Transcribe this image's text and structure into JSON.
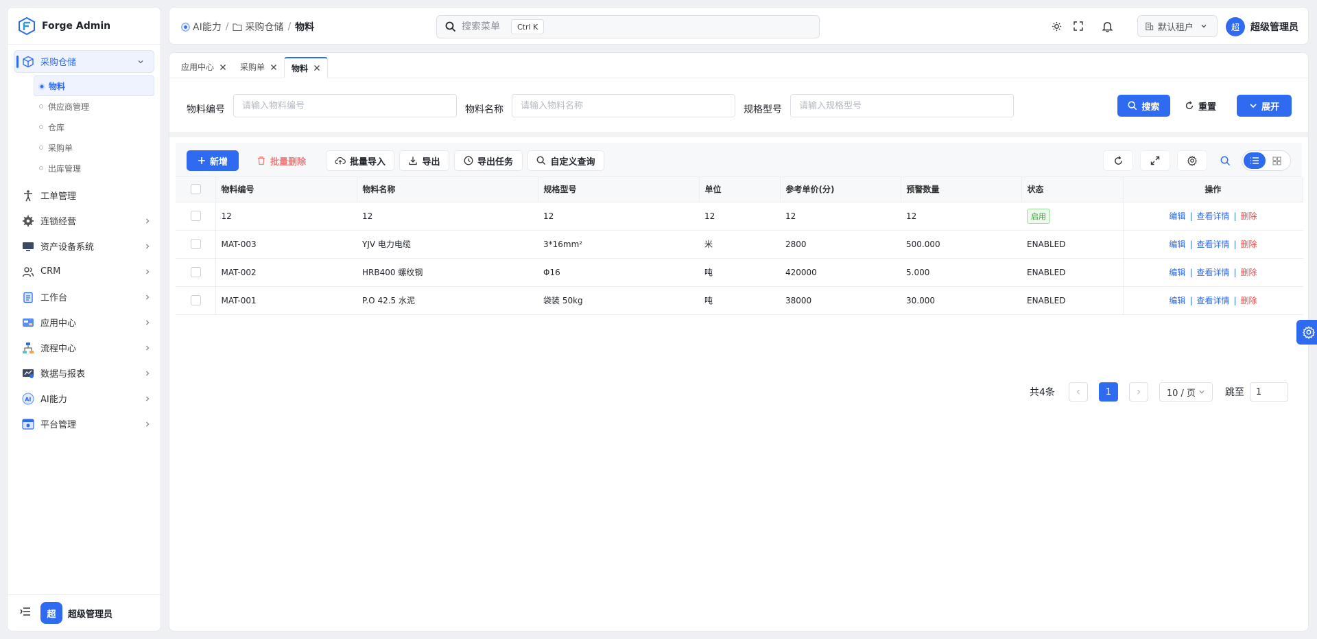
{
  "app": {
    "name": "Forge Admin"
  },
  "sidebar": {
    "open_group": {
      "label": "采购仓储",
      "icon": "cube-icon"
    },
    "sub_items": [
      {
        "label": "物料",
        "active": true
      },
      {
        "label": "供应商管理"
      },
      {
        "label": "仓库"
      },
      {
        "label": "采购单"
      },
      {
        "label": "出库管理"
      }
    ],
    "items": [
      {
        "label": "工单管理",
        "icon": "person-icon",
        "arrow": false
      },
      {
        "label": "连锁经营",
        "icon": "gear-icon",
        "arrow": true
      },
      {
        "label": "资产设备系统",
        "icon": "monitor-icon",
        "arrow": true
      },
      {
        "label": "CRM",
        "icon": "users-icon",
        "arrow": true
      },
      {
        "label": "工作台",
        "icon": "clipboard-icon",
        "arrow": true
      },
      {
        "label": "应用中心",
        "icon": "app-icon",
        "arrow": true
      },
      {
        "label": "流程中心",
        "icon": "flow-icon",
        "arrow": true
      },
      {
        "label": "数据与报表",
        "icon": "report-icon",
        "arrow": true
      },
      {
        "label": "AI能力",
        "icon": "ai-icon",
        "arrow": true
      },
      {
        "label": "平台管理",
        "icon": "platform-icon",
        "arrow": true
      }
    ],
    "bottom_user": {
      "avatar": "超",
      "name": "超级管理员"
    }
  },
  "header": {
    "breadcrumbs": [
      "AI能力",
      "采购仓储",
      "物料"
    ],
    "search": {
      "placeholder": "搜索菜单",
      "shortcut": "Ctrl K"
    },
    "tenant": "默认租户",
    "user": {
      "avatar": "超",
      "name": "超级管理员"
    }
  },
  "tabs": [
    {
      "label": "应用中心"
    },
    {
      "label": "采购单"
    },
    {
      "label": "物料",
      "active": true
    }
  ],
  "filter": {
    "fields": [
      {
        "label": "物料编号",
        "placeholder": "请输入物料编号",
        "value": ""
      },
      {
        "label": "物料名称",
        "placeholder": "请输入物料名称",
        "value": ""
      },
      {
        "label": "规格型号",
        "placeholder": "请输入规格型号",
        "value": ""
      }
    ],
    "search_label": "搜索",
    "reset_label": "重置",
    "expand_label": "展开"
  },
  "toolbar": {
    "add": "新增",
    "batch_delete": "批量删除",
    "batch_import": "批量导入",
    "export": "导出",
    "export_tasks": "导出任务",
    "custom_query": "自定义查询"
  },
  "table": {
    "columns": [
      "物料编号",
      "物料名称",
      "规格型号",
      "单位",
      "参考单价(分)",
      "预警数量",
      "状态",
      "操作"
    ],
    "rows": [
      {
        "code": "12",
        "name": "12",
        "spec": "12",
        "unit": "12",
        "price": "12",
        "warn": "12",
        "status": "启用",
        "status_tag": true
      },
      {
        "code": "MAT-003",
        "name": "YJV 电力电缆",
        "spec": "3*16mm²",
        "unit": "米",
        "price": "2800",
        "warn": "500.000",
        "status": "ENABLED"
      },
      {
        "code": "MAT-002",
        "name": "HRB400 螺纹钢",
        "spec": "Φ16",
        "unit": "吨",
        "price": "420000",
        "warn": "5.000",
        "status": "ENABLED"
      },
      {
        "code": "MAT-001",
        "name": "P.O 42.5 水泥",
        "spec": "袋装 50kg",
        "unit": "吨",
        "price": "38000",
        "warn": "30.000",
        "status": "ENABLED"
      }
    ],
    "ops": {
      "edit": "编辑",
      "detail": "查看详情",
      "delete": "删除",
      "sep": "|"
    }
  },
  "pagination": {
    "total_text": "共4条",
    "current_page": "1",
    "page_size": "10 / 页",
    "jump_label": "跳至",
    "jump_value": "1"
  },
  "colors": {
    "primary": "#2f6bf0",
    "danger": "#f04b4b",
    "success": "#3c9a3c"
  }
}
